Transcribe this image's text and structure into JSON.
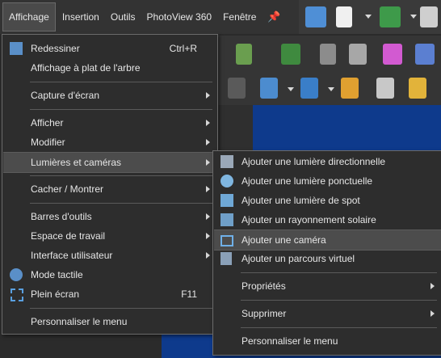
{
  "menubar": {
    "items": [
      "Affichage",
      "Insertion",
      "Outils",
      "PhotoView 360",
      "Fenêtre"
    ],
    "pin": "📌"
  },
  "main_menu": {
    "items": [
      {
        "label": "Redessiner",
        "shortcut": "Ctrl+R"
      },
      {
        "label": "Affichage à plat de l'arbre"
      },
      {
        "label": "Capture d'écran"
      },
      {
        "label": "Afficher"
      },
      {
        "label": "Modifier"
      },
      {
        "label": "Lumières et caméras"
      },
      {
        "label": "Cacher / Montrer"
      },
      {
        "label": "Barres d'outils"
      },
      {
        "label": "Espace de travail"
      },
      {
        "label": "Interface utilisateur"
      },
      {
        "label": "Mode tactile"
      },
      {
        "label": "Plein écran",
        "shortcut": "F11"
      },
      {
        "label": "Personnaliser le menu"
      }
    ]
  },
  "sub_menu": {
    "items": [
      {
        "label": "Ajouter une lumière directionnelle"
      },
      {
        "label": "Ajouter une lumière ponctuelle"
      },
      {
        "label": "Ajouter une lumière de spot"
      },
      {
        "label": "Ajouter un rayonnement solaire"
      },
      {
        "label": "Ajouter une caméra"
      },
      {
        "label": "Ajouter un parcours virtuel"
      },
      {
        "label": "Propriétés"
      },
      {
        "label": "Supprimer"
      },
      {
        "label": "Personnaliser le menu"
      }
    ]
  },
  "colors": {
    "menu_bg": "#2d2d2d",
    "highlight": "#4c4c4c",
    "viewport_blue": "#0e3a8c"
  }
}
